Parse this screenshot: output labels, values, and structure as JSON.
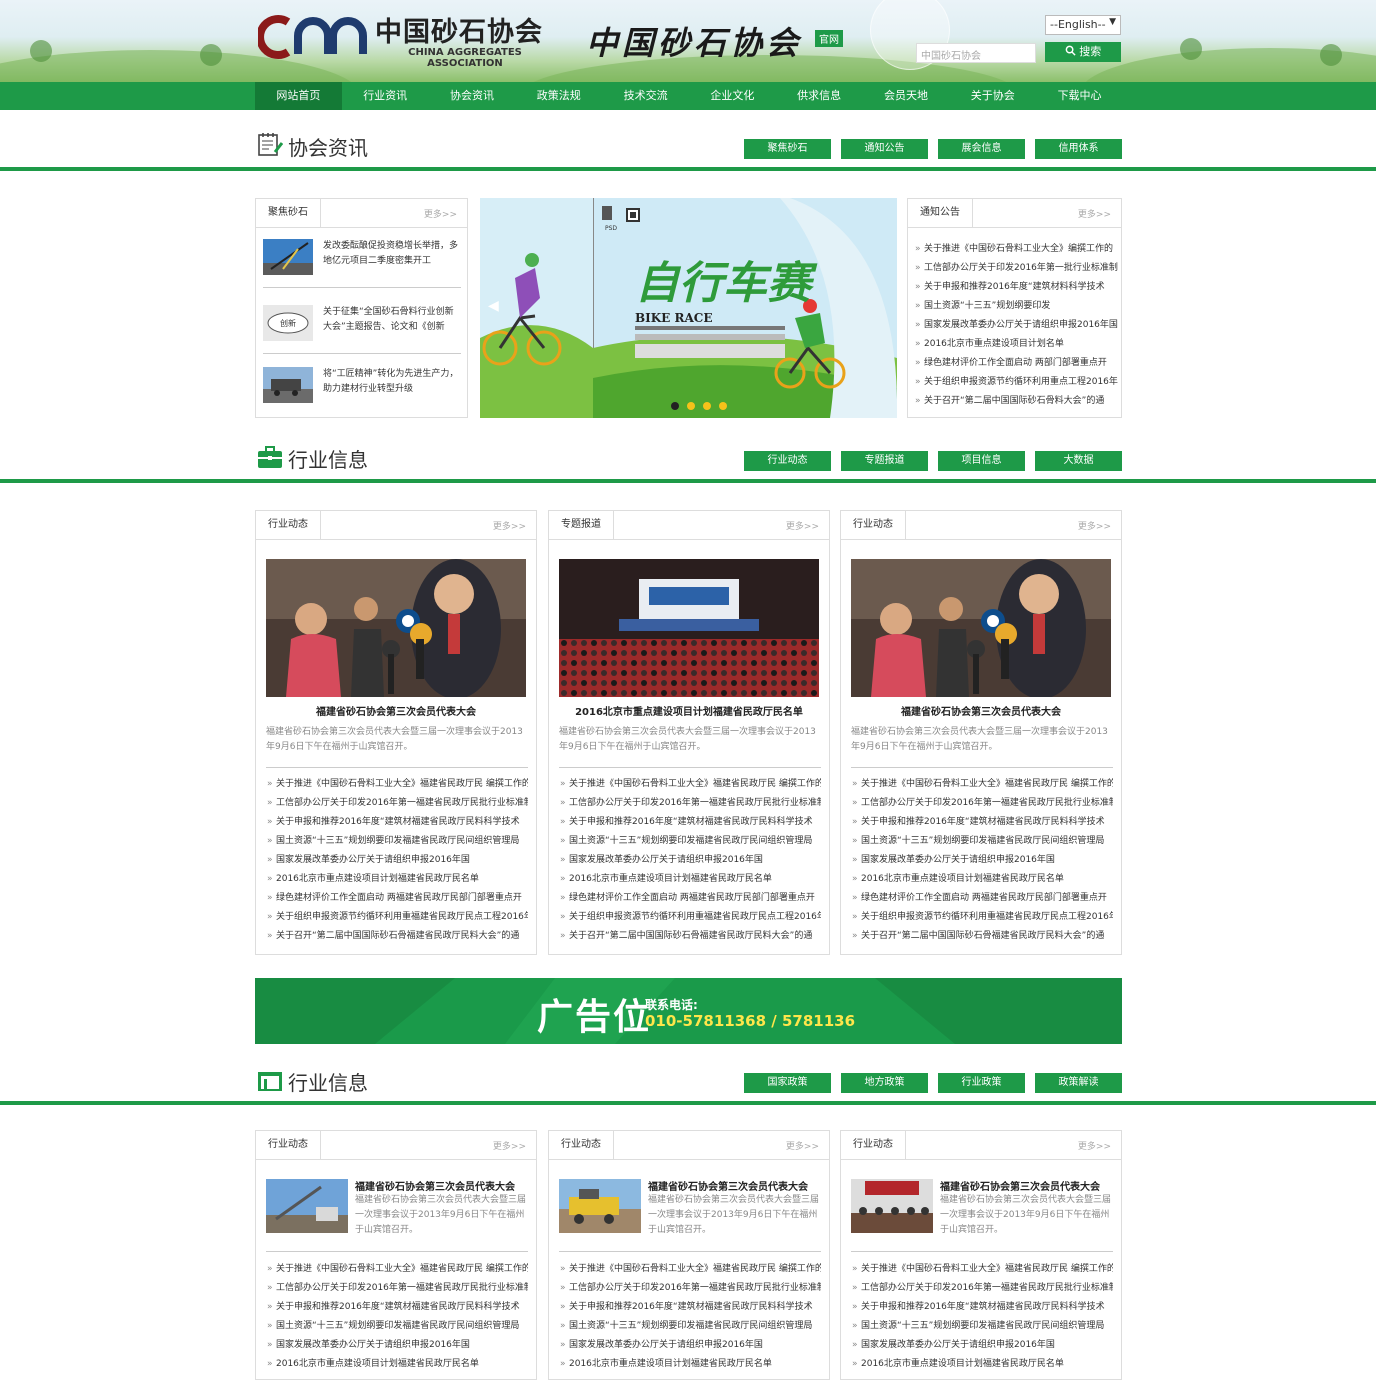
{
  "header": {
    "logo_text": "CAA",
    "logo_cn": "中国砂石协会",
    "logo_en_line1": "CHINA AGGREGATES",
    "logo_en_line2": "ASSOCIATION",
    "calligraphy": "中国砂石协会",
    "official_badge": "官网",
    "language_select": "--English--",
    "search_placeholder": "中国砂石协会",
    "search_button": "搜索"
  },
  "nav": {
    "items": [
      "网站首页",
      "行业资讯",
      "协会资讯",
      "政策法规",
      "技术交流",
      "企业文化",
      "供求信息",
      "会员天地",
      "关于协会",
      "下载中心"
    ],
    "active_index": 0
  },
  "section1": {
    "title": "协会资讯",
    "tabs": [
      "聚焦砂石",
      "通知公告",
      "展会信息",
      "信用体系"
    ],
    "focus_box": {
      "tab": "聚焦砂石",
      "more": "更多>>",
      "items": [
        "发改委酝酿促投资稳增长举措，多地亿元项目二季度密集开工",
        "关于征集“全国砂石骨料行业创新大会”主题报告、论文和《创新",
        "将“工匠精神”转化为先进生产力，助力建材行业转型升级"
      ]
    },
    "slider": {
      "headline": "自行车赛",
      "subtitle": "BIKE RACE",
      "dots": 4,
      "active_dot": 0
    },
    "notice_box": {
      "tab": "通知公告",
      "more": "更多>>",
      "items": [
        "关于推进《中国砂石骨料工业大全》编撰工作的",
        "工信部办公厅关于印发2016年第一批行业标准制",
        "关于申报和推荐2016年度“建筑材料科学技术",
        "国土资源“十三五”规划纲要印发",
        "国家发展改革委办公厅关于请组织申报2016年国",
        "2016北京市重点建设项目计划名单",
        "绿色建材评价工作全面启动 两部门部署重点开",
        "关于组织申报资源节约循环利用重点工程2016年",
        "关于召开“第二届中国国际砂石骨料大会”的通"
      ]
    }
  },
  "section2": {
    "title": "行业信息",
    "tabs": [
      "行业动态",
      "专题报道",
      "项目信息",
      "大数据"
    ],
    "cards": [
      {
        "tab": "行业动态",
        "more": "更多>>",
        "title": "福建省砂石协会第三次会员代表大会",
        "desc": "福建省砂石协会第三次会员代表大会暨三届一次理事会议于2013年9月6日下午在福州于山宾馆召开。"
      },
      {
        "tab": "专题报道",
        "more": "更多>>",
        "title": "2016北京市重点建设项目计划福建省民政厅民名单",
        "desc": "福建省砂石协会第三次会员代表大会暨三届一次理事会议于2013年9月6日下午在福州于山宾馆召开。"
      },
      {
        "tab": "行业动态",
        "more": "更多>>",
        "title": "福建省砂石协会第三次会员代表大会",
        "desc": "福建省砂石协会第三次会员代表大会暨三届一次理事会议于2013年9月6日下午在福州于山宾馆召开。"
      }
    ],
    "list_items": [
      "关于推进《中国砂石骨料工业大全》福建省民政厅民 编撰工作的",
      "工信部办公厅关于印发2016年第一福建省民政厅民批行业标准制",
      "关于申报和推荐2016年度“建筑材福建省民政厅民料科学技术",
      "国土资源“十三五”规划纲要印发福建省民政厅民间组织管理局",
      "国家发展改革委办公厅关于请组织申报2016年国",
      "2016北京市重点建设项目计划福建省民政厅民名单",
      "绿色建材评价工作全面启动 两福建省民政厅民部门部署重点开",
      "关于组织申报资源节约循环利用重福建省民政厅民点工程2016年",
      "关于召开“第二届中国国际砂石骨福建省民政厅民料大会”的通"
    ]
  },
  "ad": {
    "main": "广告位",
    "label": "联系电话:",
    "phone": "010-57811368 / 5781136"
  },
  "section3": {
    "title": "行业信息",
    "tabs": [
      "国家政策",
      "地方政策",
      "行业政策",
      "政策解读"
    ],
    "cards": [
      {
        "tab": "行业动态",
        "more": "更多>>",
        "title": "福建省砂石协会第三次会员代表大会",
        "desc": "福建省砂石协会第三次会员代表大会暨三届一次理事会议于2013年9月6日下午在福州于山宾馆召开。"
      },
      {
        "tab": "行业动态",
        "more": "更多>>",
        "title": "福建省砂石协会第三次会员代表大会",
        "desc": "福建省砂石协会第三次会员代表大会暨三届一次理事会议于2013年9月6日下午在福州于山宾馆召开。"
      },
      {
        "tab": "行业动态",
        "more": "更多>>",
        "title": "福建省砂石协会第三次会员代表大会",
        "desc": "福建省砂石协会第三次会员代表大会暨三届一次理事会议于2013年9月6日下午在福州于山宾馆召开。"
      }
    ],
    "list_items": [
      "关于推进《中国砂石骨料工业大全》福建省民政厅民 编撰工作的",
      "工信部办公厅关于印发2016年第一福建省民政厅民批行业标准制",
      "关于申报和推荐2016年度“建筑材福建省民政厅民料科学技术",
      "国土资源“十三五”规划纲要印发福建省民政厅民间组织管理局",
      "国家发展改革委办公厅关于请组织申报2016年国",
      "2016北京市重点建设项目计划福建省民政厅民名单"
    ]
  },
  "colors": {
    "brand_green": "#1e9a48",
    "dark_green": "#147a36",
    "phone_yellow": "#ffe64a"
  }
}
